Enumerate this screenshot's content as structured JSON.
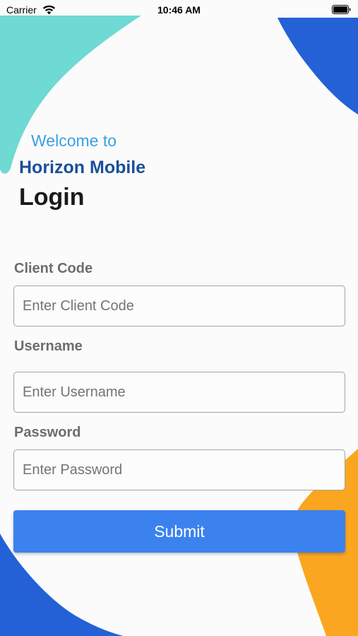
{
  "status_bar": {
    "carrier": "Carrier",
    "time": "10:46 AM",
    "wifi_icon": "wifi-icon",
    "battery_icon": "battery-full-icon"
  },
  "header": {
    "welcome": "Welcome to",
    "app_name": "Horizon Mobile",
    "title": "Login"
  },
  "form": {
    "client_code": {
      "label": "Client Code",
      "placeholder": "Enter Client Code",
      "value": ""
    },
    "username": {
      "label": "Username",
      "placeholder": "Enter Username",
      "value": ""
    },
    "password": {
      "label": "Password",
      "placeholder": "Enter Password",
      "value": ""
    },
    "submit_label": "Submit"
  },
  "colors": {
    "teal_blob": "#6fd9d4",
    "blue_blob": "#2461d6",
    "orange_blob": "#fba621",
    "button": "#3b82ef",
    "welcome_text": "#3aa0e3",
    "app_name_text": "#1a4e9c"
  }
}
